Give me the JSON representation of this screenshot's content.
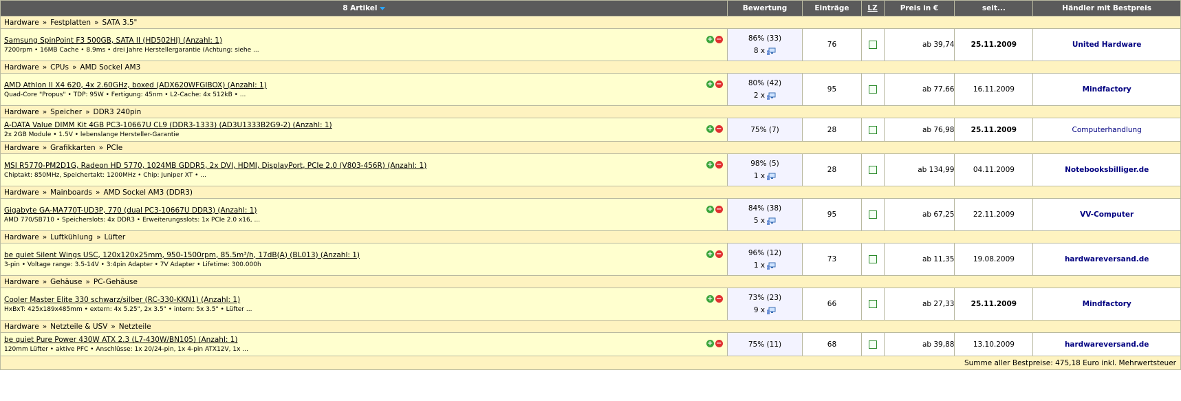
{
  "header": {
    "articles": "8 Artikel",
    "rating": "Bewertung",
    "entries": "Einträge",
    "lz": "LZ",
    "price": "Preis in €",
    "since": "seit...",
    "dealer": "Händler mit Bestpreis"
  },
  "items": [
    {
      "cat": [
        "Hardware",
        "Festplatten",
        "SATA 3.5\""
      ],
      "title": "Samsung SpinPoint F3 500GB, SATA II (HD502HJ) (Anzahl: 1)",
      "desc": "7200rpm • 16MB Cache • 8.9ms • drei Jahre Herstellergarantie (Achtung: siehe ...",
      "rating": "86% (33)",
      "ratings_count": "8 x",
      "entries": "76",
      "price": "ab 39,74",
      "date": "25.11.2009",
      "date_bold": true,
      "dealer": "United Hardware",
      "dealer_bold": true
    },
    {
      "cat": [
        "Hardware",
        "CPUs",
        "AMD Sockel AM3"
      ],
      "title": "AMD Athlon II X4 620, 4x 2.60GHz, boxed (ADX620WFGIBOX) (Anzahl: 1)",
      "desc": "Quad-Core \"Propus\" • TDP: 95W • Fertigung: 45nm • L2-Cache: 4x 512kB • ...",
      "rating": "80% (42)",
      "ratings_count": "2 x",
      "entries": "95",
      "price": "ab 77,66",
      "date": "16.11.2009",
      "date_bold": false,
      "dealer": "Mindfactory",
      "dealer_bold": true
    },
    {
      "cat": [
        "Hardware",
        "Speicher",
        "DDR3 240pin"
      ],
      "title": "A-DATA Value DIMM Kit 4GB PC3-10667U CL9 (DDR3-1333) (AD3U1333B2G9-2) (Anzahl: 1)",
      "desc": "2x 2GB Module • 1.5V • lebenslange Hersteller-Garantie",
      "rating": "75% (7)",
      "ratings_count": "",
      "entries": "28",
      "price": "ab 76,98",
      "date": "25.11.2009",
      "date_bold": true,
      "dealer": "Computerhandlung",
      "dealer_bold": false,
      "short": true
    },
    {
      "cat": [
        "Hardware",
        "Grafikkarten",
        "PCIe"
      ],
      "title": "MSI R5770-PM2D1G, Radeon HD 5770, 1024MB GDDR5, 2x DVI, HDMI, DisplayPort, PCIe 2.0 (V803-456R) (Anzahl: 1)",
      "desc": "Chiptakt: 850MHz, Speichertakt: 1200MHz • Chip: Juniper XT • ...",
      "rating": "98% (5)",
      "ratings_count": "1 x",
      "entries": "28",
      "price": "ab 134,99",
      "date": "04.11.2009",
      "date_bold": false,
      "dealer": "Notebooksbilliger.de",
      "dealer_bold": true
    },
    {
      "cat": [
        "Hardware",
        "Mainboards",
        "AMD Sockel AM3 (DDR3)"
      ],
      "title": "Gigabyte GA-MA770T-UD3P, 770 (dual PC3-10667U DDR3) (Anzahl: 1)",
      "desc": "AMD 770/SB710 • Speicherslots: 4x DDR3 • Erweiterungsslots: 1x PCIe 2.0 x16, ...",
      "rating": "84% (38)",
      "ratings_count": "5 x",
      "entries": "95",
      "price": "ab 67,25",
      "date": "22.11.2009",
      "date_bold": false,
      "dealer": "VV-Computer",
      "dealer_bold": true
    },
    {
      "cat": [
        "Hardware",
        "Luftkühlung",
        "Lüfter"
      ],
      "title": "be quiet Silent Wings USC, 120x120x25mm, 950-1500rpm, 85.5m³/h, 17dB(A) (BL013) (Anzahl: 1)",
      "desc": "3-pin • Voltage range: 3.5-14V • 3:4pin Adapter • 7V Adapter • Lifetime: 300.000h",
      "rating": "96% (12)",
      "ratings_count": "1 x",
      "entries": "73",
      "price": "ab 11,35",
      "date": "19.08.2009",
      "date_bold": false,
      "dealer": "hardwareversand.de",
      "dealer_bold": true
    },
    {
      "cat": [
        "Hardware",
        "Gehäuse",
        "PC-Gehäuse"
      ],
      "title": "Cooler Master Elite 330 schwarz/silber (RC-330-KKN1) (Anzahl: 1)",
      "desc": "HxBxT: 425x189x485mm • extern: 4x 5.25\", 2x 3.5\" • intern: 5x 3.5\" • Lüfter ...",
      "rating": "73% (23)",
      "ratings_count": "9 x",
      "entries": "66",
      "price": "ab 27,33",
      "date": "25.11.2009",
      "date_bold": true,
      "dealer": "Mindfactory",
      "dealer_bold": true
    },
    {
      "cat": [
        "Hardware",
        "Netzteile & USV",
        "Netzteile"
      ],
      "title": "be quiet Pure Power 430W ATX 2.3 (L7-430W/BN105) (Anzahl: 1)",
      "desc": "120mm Lüfter • aktive PFC • Anschlüsse: 1x 20/24-pin, 1x 4-pin ATX12V, 1x ...",
      "rating": "75% (11)",
      "ratings_count": "",
      "entries": "68",
      "price": "ab 39,88",
      "date": "13.10.2009",
      "date_bold": false,
      "dealer": "hardwareversand.de",
      "dealer_bold": true,
      "short": true
    }
  ],
  "summary": "Summe aller Bestpreise: 475,18 Euro inkl. Mehrwertsteuer",
  "icons": {
    "sort": "sort-desc-icon",
    "add": "plus-icon",
    "remove": "minus-icon",
    "rating": "monitor-user-icon",
    "lz": "checkbox"
  }
}
